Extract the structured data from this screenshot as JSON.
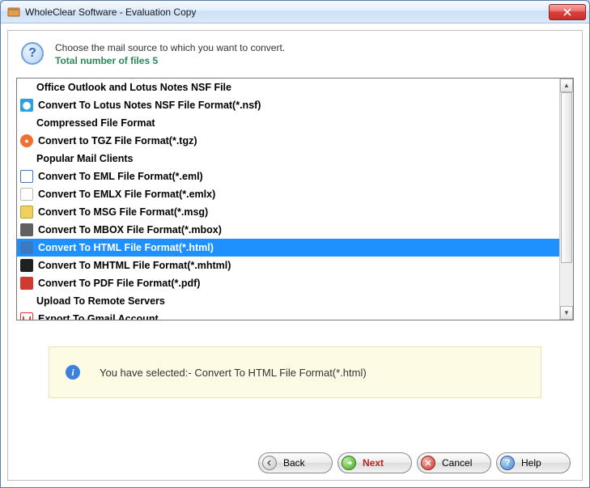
{
  "titlebar": {
    "title": "WholeClear Software - Evaluation Copy"
  },
  "header": {
    "prompt": "Choose the mail source to which you want to convert.",
    "subline": "Total number of files 5"
  },
  "list": {
    "rows": [
      {
        "kind": "header",
        "label": "Office Outlook and Lotus Notes NSF File"
      },
      {
        "kind": "item",
        "icon": "nsf-icon",
        "label": "Convert To Lotus Notes NSF File Format(*.nsf)"
      },
      {
        "kind": "header",
        "label": "Compressed File Format"
      },
      {
        "kind": "item",
        "icon": "tgz-icon",
        "label": "Convert to TGZ File Format(*.tgz)"
      },
      {
        "kind": "header",
        "label": "Popular Mail Clients"
      },
      {
        "kind": "item",
        "icon": "eml-icon",
        "label": "Convert To EML File Format(*.eml)"
      },
      {
        "kind": "item",
        "icon": "emlx-icon",
        "label": "Convert To EMLX File Format(*.emlx)"
      },
      {
        "kind": "item",
        "icon": "msg-icon",
        "label": "Convert To MSG File Format(*.msg)"
      },
      {
        "kind": "item",
        "icon": "mbox-icon",
        "label": "Convert To MBOX File Format(*.mbox)"
      },
      {
        "kind": "item",
        "icon": "html-icon",
        "label": "Convert To HTML File Format(*.html)",
        "selected": true
      },
      {
        "kind": "item",
        "icon": "mhtml-icon",
        "label": "Convert To MHTML File Format(*.mhtml)"
      },
      {
        "kind": "item",
        "icon": "pdf-icon",
        "label": "Convert To PDF File Format(*.pdf)"
      },
      {
        "kind": "header",
        "label": "Upload To Remote Servers"
      },
      {
        "kind": "item",
        "icon": "gmail-icon",
        "label": "Export To Gmail Account"
      }
    ]
  },
  "status": {
    "text": "You have selected:- Convert To HTML File Format(*.html)"
  },
  "buttons": {
    "back": "Back",
    "next": "Next",
    "cancel": "Cancel",
    "help": "Help"
  }
}
